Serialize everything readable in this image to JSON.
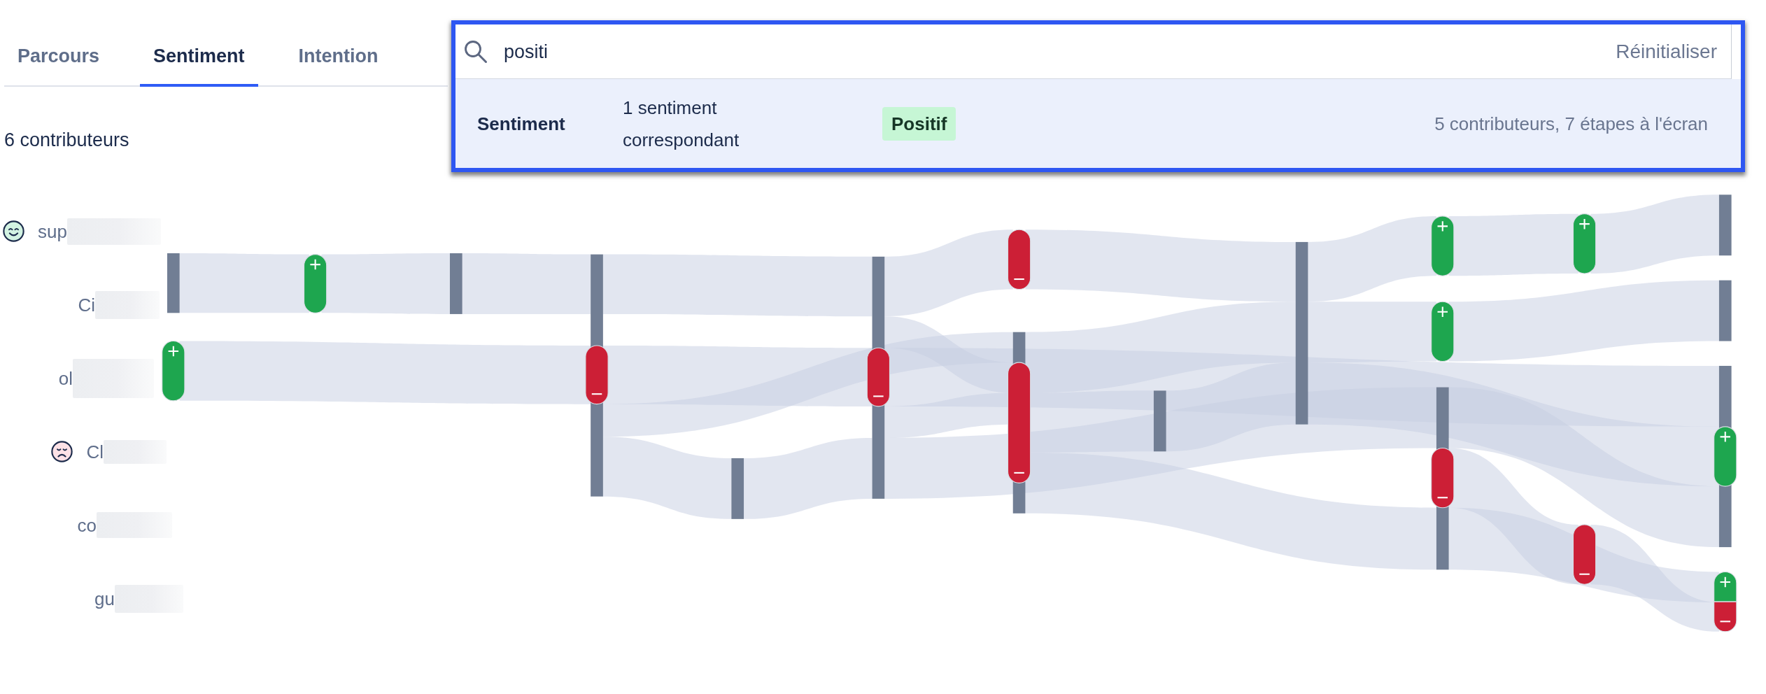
{
  "tabs": [
    {
      "label": "Parcours",
      "selected": false
    },
    {
      "label": "Sentiment",
      "selected": true
    },
    {
      "label": "Intention",
      "selected": false
    }
  ],
  "contributor_count": "6 contributeurs",
  "contributors": [
    {
      "label": "sup",
      "kind": "positive"
    },
    {
      "label": "Ci",
      "kind": "plain"
    },
    {
      "label": "ol",
      "kind": "plain"
    },
    {
      "label": "Cl",
      "kind": "negative"
    },
    {
      "label": "co",
      "kind": "plain"
    },
    {
      "label": "gu",
      "kind": "plain"
    }
  ],
  "search": {
    "value": "positi",
    "reset_label": "Réinitialiser",
    "results": [
      {
        "category": "Sentiment",
        "match_count": "1 sentiment correspondant",
        "tag": "Positif",
        "summary": "5 contributeurs, 7 étapes à l'écran",
        "selected": true
      }
    ]
  }
}
